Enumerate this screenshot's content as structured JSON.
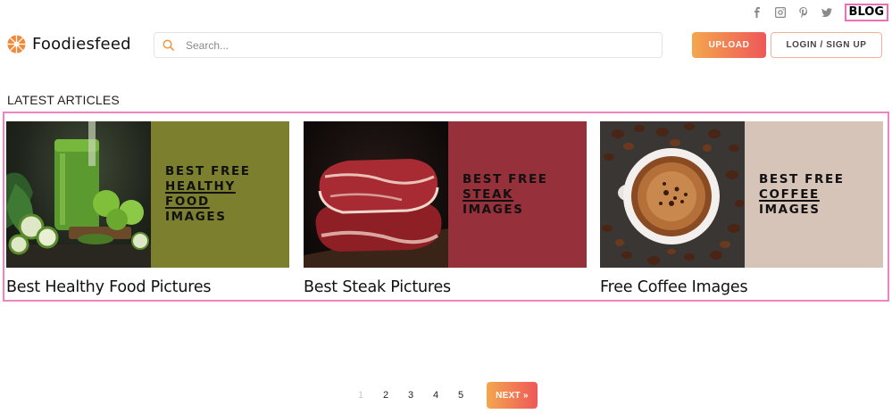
{
  "social": {
    "icons": [
      "facebook-icon",
      "instagram-icon",
      "pinterest-icon",
      "twitter-icon"
    ],
    "blog_label": "BLOG"
  },
  "header": {
    "logo_text": "Foodiesfeed",
    "search_placeholder": "Search...",
    "upload_label": "UPLOAD",
    "login_label": "LOGIN / SIGN UP"
  },
  "section": {
    "title": "LATEST ARTICLES"
  },
  "articles": [
    {
      "title": "Best Healthy Food Pictures",
      "banner_line1": "BEST FREE",
      "banner_line2": "HEALTHY",
      "banner_line3": "FOOD",
      "banner_line4": "IMAGES",
      "panel_color": "#7b7f2e",
      "photo_subject": "green-smoothie-image"
    },
    {
      "title": "Best Steak Pictures",
      "banner_line1": "BEST FREE",
      "banner_line2": "STEAK",
      "banner_line3": "IMAGES",
      "panel_color": "#96303b",
      "photo_subject": "raw-steak-image"
    },
    {
      "title": "Free Coffee Images",
      "banner_line1": "BEST FREE",
      "banner_line2": "COFFEE",
      "banner_line3": "IMAGES",
      "panel_color": "#d7c4b9",
      "photo_subject": "coffee-cup-image"
    }
  ],
  "pagination": {
    "pages": [
      "1",
      "2",
      "3",
      "4",
      "5"
    ],
    "current": "1",
    "next_label": "NEXT »"
  },
  "colors": {
    "accent_start": "#f4a64e",
    "accent_end": "#ee5858",
    "highlight_border": "#ee85c2"
  }
}
